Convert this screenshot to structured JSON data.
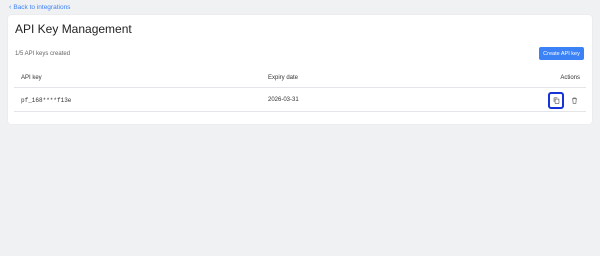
{
  "nav": {
    "back_label": "Back to integrations"
  },
  "header": {
    "title": "API Key Management"
  },
  "summary": {
    "count_text": "1/5 API keys created"
  },
  "toolbar": {
    "create_label": "Create API key"
  },
  "table": {
    "columns": [
      "API key",
      "Expiry date",
      "Actions"
    ],
    "rows": [
      {
        "key": "pf_168****f13e",
        "expiry": "2026-03-31",
        "actions": [
          "copy-icon",
          "trash-icon"
        ]
      }
    ]
  },
  "colors": {
    "accent": "#3b82f6",
    "highlight": "#1533d6",
    "background": "#f0f1f3"
  }
}
